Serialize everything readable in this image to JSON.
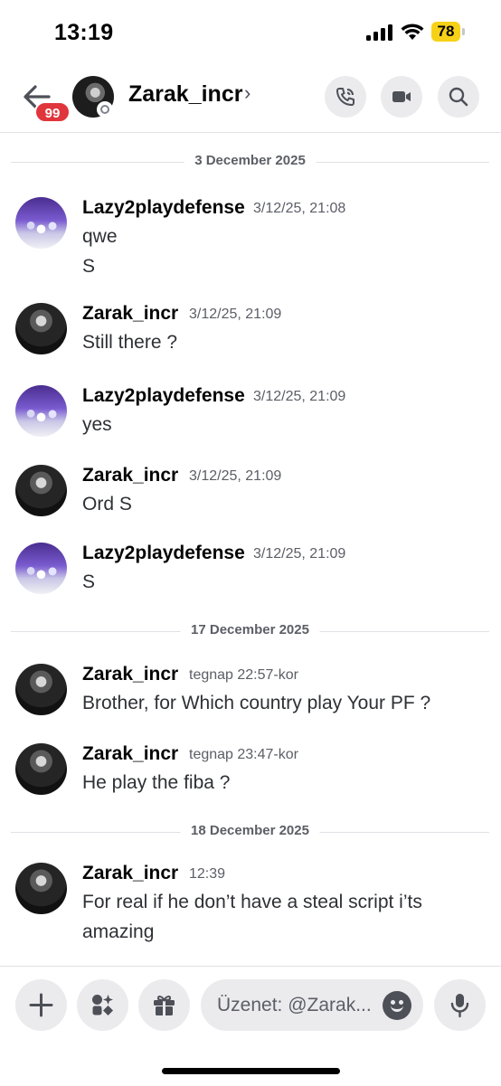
{
  "status_bar": {
    "time": "13:19",
    "battery": "78"
  },
  "header": {
    "unread_badge": "99",
    "channel_name": "Zarak_incr",
    "chevron": "›"
  },
  "conversation": [
    {
      "type": "date",
      "label": "3 December 2025"
    },
    {
      "type": "message",
      "author": "Lazy2playdefense",
      "avatar": "lazy",
      "timestamp": "3/12/25, 21:08",
      "lines": [
        "qwe",
        "S"
      ]
    },
    {
      "type": "message",
      "author": "Zarak_incr",
      "avatar": "zarak",
      "timestamp": "3/12/25, 21:09",
      "lines": [
        "Still there ?"
      ]
    },
    {
      "type": "message",
      "author": "Lazy2playdefense",
      "avatar": "lazy",
      "timestamp": "3/12/25, 21:09",
      "lines": [
        "yes"
      ]
    },
    {
      "type": "message",
      "author": "Zarak_incr",
      "avatar": "zarak",
      "timestamp": "3/12/25, 21:09",
      "lines": [
        "Ord S"
      ]
    },
    {
      "type": "message",
      "author": "Lazy2playdefense",
      "avatar": "lazy",
      "timestamp": "3/12/25, 21:09",
      "lines": [
        "S"
      ]
    },
    {
      "type": "date",
      "label": "17 December 2025"
    },
    {
      "type": "message",
      "author": "Zarak_incr",
      "avatar": "zarak",
      "timestamp": "tegnap 22:57-kor",
      "lines": [
        "Brother, for Which country play Your PF ?"
      ]
    },
    {
      "type": "message",
      "author": "Zarak_incr",
      "avatar": "zarak",
      "timestamp": "tegnap 23:47-kor",
      "lines": [
        "He play the fiba ?"
      ]
    },
    {
      "type": "date",
      "label": "18 December 2025"
    },
    {
      "type": "message",
      "author": "Zarak_incr",
      "avatar": "zarak",
      "timestamp": "12:39",
      "lines": [
        "For real if he don’t have a steal script i’ts",
        "amazing"
      ]
    }
  ],
  "composer": {
    "placeholder": "Üzenet: @Zarak..."
  },
  "icons": {
    "back": "arrow-left-icon",
    "call": "phone-icon",
    "video": "video-camera-icon",
    "search": "search-icon",
    "add": "plus-icon",
    "apps": "apps-icon",
    "gift": "gift-icon",
    "emoji": "emoji-icon",
    "voice": "microphone-icon"
  },
  "colors": {
    "badge": "#e0353c",
    "battery": "#f7d117",
    "button_bg": "#ebebee"
  }
}
